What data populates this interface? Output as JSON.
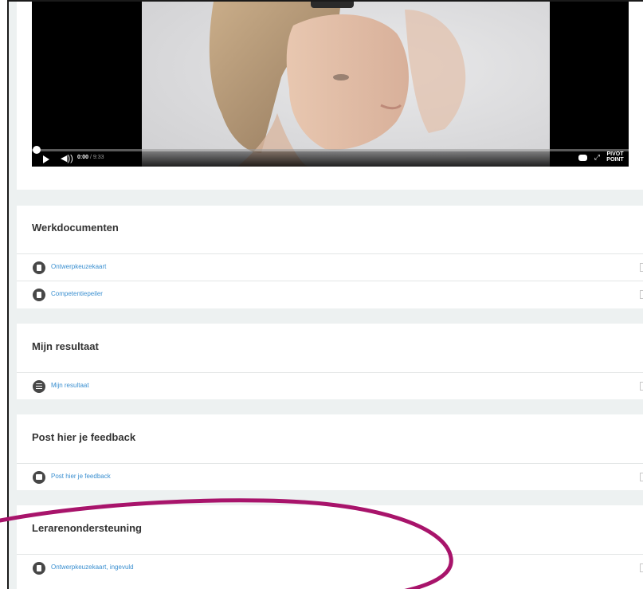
{
  "video": {
    "time_current": "0:00",
    "time_total": "/ 9:33",
    "brand": "PIVOT POINT"
  },
  "sections": {
    "werkdocumenten": {
      "title": "Werkdocumenten",
      "items": [
        {
          "label": "Ontwerpkeuzekaart",
          "icon": "document-icon"
        },
        {
          "label": "Competentiepeiler",
          "icon": "document-icon"
        }
      ]
    },
    "resultaat": {
      "title": "Mijn resultaat",
      "items": [
        {
          "label": "Mijn resultaat",
          "icon": "list-icon"
        }
      ]
    },
    "feedback": {
      "title": "Post hier je feedback",
      "items": [
        {
          "label": "Post hier je feedback",
          "icon": "forum-icon"
        }
      ]
    },
    "leraren": {
      "title": "Lerarenondersteuning",
      "items": [
        {
          "label": "Ontwerpkeuzekaart, ingevuld",
          "icon": "document-icon"
        }
      ]
    }
  },
  "colors": {
    "link": "#3a8fd0",
    "annotation": "#a8146b",
    "page_bg": "#edf1f1"
  }
}
